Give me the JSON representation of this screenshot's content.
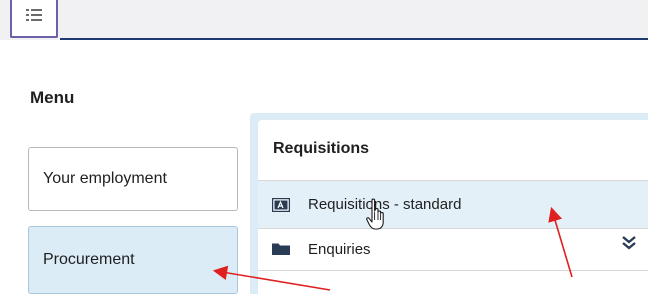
{
  "menu": {
    "heading": "Menu",
    "items": [
      {
        "label": "Your employment"
      },
      {
        "label": "Procurement",
        "selected": true
      }
    ]
  },
  "panel": {
    "title": "Requisitions",
    "rows": [
      {
        "label": "Requisitions - standard",
        "icon": "form-icon",
        "highlighted": true
      },
      {
        "label": "Enquiries",
        "icon": "folder-icon"
      }
    ]
  },
  "colors": {
    "accent": "#1e3a6e",
    "selected_bg": "#dcecf6",
    "annotation_arrow": "#e02020"
  },
  "icons": [
    "menu-list-icon",
    "form-icon",
    "folder-icon",
    "double-chevron-down-icon",
    "hand-cursor-icon"
  ]
}
